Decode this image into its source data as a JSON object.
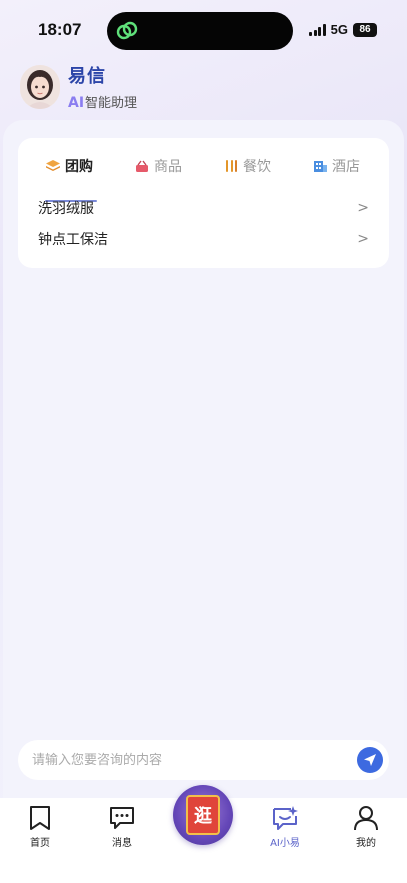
{
  "status_bar": {
    "time": "18:07",
    "network": "5G",
    "battery": "86"
  },
  "header": {
    "brand_name": "易信",
    "sub_prefix": "AI",
    "sub_text": "智能助理"
  },
  "tabs": [
    {
      "label": "团购",
      "icon": "stack-icon",
      "active": true
    },
    {
      "label": "商品",
      "icon": "basket-icon",
      "active": false
    },
    {
      "label": "餐饮",
      "icon": "cutlery-icon",
      "active": false
    },
    {
      "label": "酒店",
      "icon": "hotel-icon",
      "active": false
    }
  ],
  "list": [
    {
      "label": "洗羽绒服",
      "chevron": ">"
    },
    {
      "label": "钟点工保洁",
      "chevron": ">"
    }
  ],
  "input": {
    "placeholder": "请输入您要咨询的内容"
  },
  "center_button": {
    "label": "逛"
  },
  "nav": [
    {
      "label": "首页",
      "icon": "bookmark-icon"
    },
    {
      "label": "消息",
      "icon": "message-icon"
    },
    {
      "label": "AI小易",
      "icon": "ai-chat-icon",
      "active": true
    },
    {
      "label": "我的",
      "icon": "user-icon"
    }
  ],
  "colors": {
    "accent": "#3d6ae0",
    "brand": "#2c45a8",
    "active_nav": "#5b63c9"
  }
}
